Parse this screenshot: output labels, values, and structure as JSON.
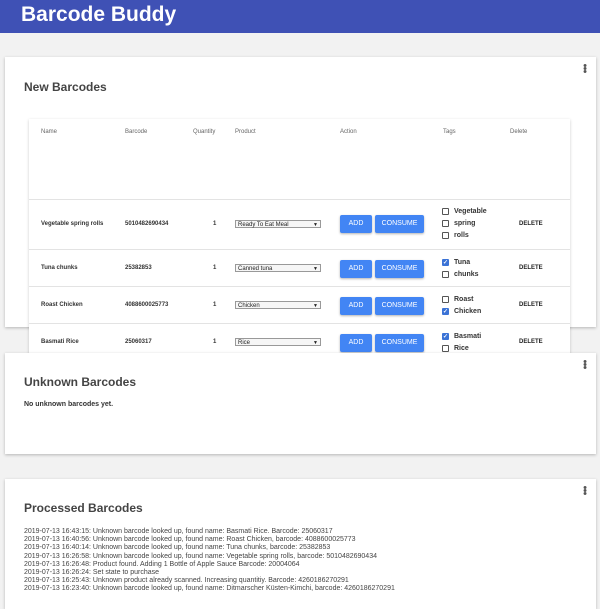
{
  "app": {
    "title": "Barcode Buddy"
  },
  "new_barcodes": {
    "title": "New Barcodes",
    "columns": [
      "Name",
      "Barcode",
      "Quantity",
      "Product",
      "Action",
      "Tags",
      "Delete"
    ],
    "add_label": "ADD",
    "consume_label": "CONSUME",
    "delete_label": "DELETE",
    "rows": [
      {
        "name": "Vegetable spring rolls",
        "barcode": "5010482690434",
        "quantity": "1",
        "product": "Ready To Eat Meal",
        "tags": [
          {
            "label": "Vegetable",
            "checked": false
          },
          {
            "label": "spring",
            "checked": false
          },
          {
            "label": "rolls",
            "checked": false
          }
        ]
      },
      {
        "name": "Tuna chunks",
        "barcode": "25382853",
        "quantity": "1",
        "product": "Canned tuna",
        "tags": [
          {
            "label": "Tuna",
            "checked": true
          },
          {
            "label": "chunks",
            "checked": false
          }
        ]
      },
      {
        "name": "Roast Chicken",
        "barcode": "4088600025773",
        "quantity": "1",
        "product": "Chicken",
        "tags": [
          {
            "label": "Roast",
            "checked": false
          },
          {
            "label": "Chicken",
            "checked": true
          }
        ]
      },
      {
        "name": "Basmati Rice",
        "barcode": "25060317",
        "quantity": "1",
        "product": "Rice",
        "tags": [
          {
            "label": "Basmati",
            "checked": true
          },
          {
            "label": "Rice",
            "checked": false
          }
        ]
      }
    ]
  },
  "unknown_barcodes": {
    "title": "Unknown Barcodes",
    "message": "No unknown barcodes yet."
  },
  "processed_barcodes": {
    "title": "Processed Barcodes",
    "log": [
      "2019-07-13 16:43:15: Unknown barcode looked up, found name: Basmati Rice. Barcode: 25060317",
      "2019-07-13 16:40:56: Unknown barcode looked up, found name: Roast Chicken, barcode: 4088600025773",
      "2019-07-13 16:40:14: Unknown barcode looked up, found name: Tuna chunks, barcode: 25382853",
      "2019-07-13 16:26:58: Unknown barcode looked up, found name: Vegetable spring rolls, barcode: 5010482690434",
      "2019-07-13 16:26:48: Product found. Adding 1 Bottle of Apple Sauce Barcode: 20004064",
      "2019-07-13 16:26:24: Set state to purchase",
      "2019-07-13 16:25:43: Unknown product already scanned. Increasing quantitiy. Barcode: 4260186270291",
      "2019-07-13 16:23:40: Unknown barcode looked up, found name: Ditmarscher Küsten-Kimchi, barcode: 4260186270291"
    ]
  },
  "colors": {
    "appbar": "#3f51b5",
    "button": "#4285f4"
  }
}
